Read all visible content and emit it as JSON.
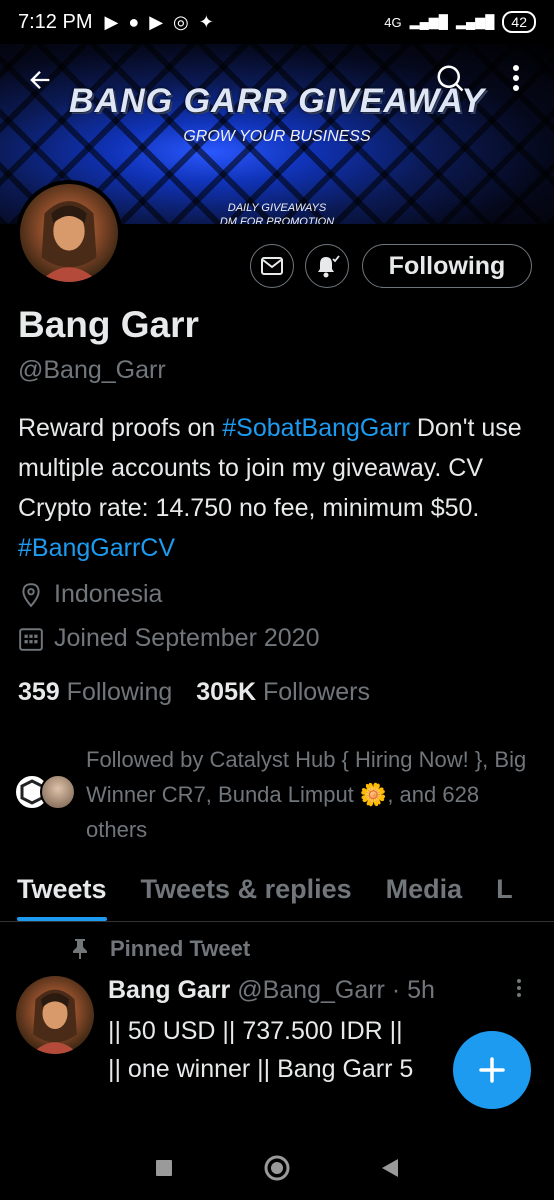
{
  "status_bar": {
    "time": "7:12 PM",
    "network": "4G",
    "battery": "42"
  },
  "banner": {
    "title": "BANG GARR GIVEAWAY",
    "subtitle": "GROW YOUR BUSINESS",
    "line1": "DAILY GIVEAWAYS",
    "line2": "DM FOR PROMOTION"
  },
  "profile": {
    "name": "Bang Garr",
    "handle": "@Bang_Garr",
    "bio_1": "Reward proofs on ",
    "bio_tag1": "#SobatBangGarr",
    "bio_2": " Don't use multiple accounts to join my giveaway. CV Crypto rate: 14.750 no fee, minimum $50. ",
    "bio_tag2": "#BangGarrCV",
    "location": "Indonesia",
    "joined": "Joined September 2020",
    "following_count": "359",
    "following_label": "Following",
    "followers_count": "305K",
    "followers_label": "Followers",
    "followed_by": "Followed by Catalyst Hub { Hiring Now! }, Big Winner CR7, Bunda Limput",
    "followed_by_tail": ", and 628 others",
    "follow_button": "Following"
  },
  "tabs": [
    {
      "label": "Tweets"
    },
    {
      "label": "Tweets & replies"
    },
    {
      "label": "Media"
    },
    {
      "label": "L"
    }
  ],
  "tweet": {
    "pinned_label": "Pinned Tweet",
    "author": "Bang Garr",
    "handle": "@Bang_Garr",
    "time": "· 5h",
    "line1": "|| 50 USD || 737.500 IDR ||",
    "line2": "|| one winner || Bang Garr 5"
  },
  "colors": {
    "accent": "#1d9bf0",
    "background": "#000000",
    "muted": "#71767b"
  }
}
